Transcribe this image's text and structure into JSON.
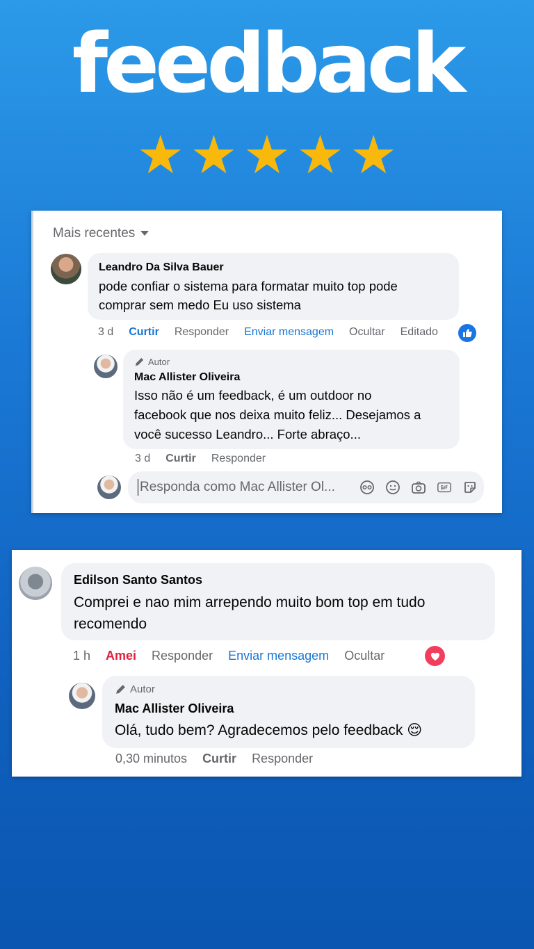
{
  "header": {
    "title": "feedback",
    "stars": [
      "★",
      "★",
      "★",
      "★",
      "★"
    ]
  },
  "card1": {
    "sort_label": "Mais recentes",
    "comment": {
      "author": "Leandro Da Silva Bauer",
      "text_line1": "pode confiar o sistema para formatar muito top pode",
      "text_line2": "comprar sem medo Eu uso sistema",
      "time": "3 d",
      "like": "Curtir",
      "reply": "Responder",
      "message": "Enviar mensagem",
      "hide": "Ocultar",
      "edited": "Editado",
      "reaction_icon": "thumbs-up-icon"
    },
    "reply": {
      "tag": "Autor",
      "author": "Mac Allister Oliveira",
      "text_line1": "Isso não é um feedback, é um outdoor no",
      "text_line2": "facebook que nos deixa muito feliz... Desejamos a",
      "text_line3": "você sucesso Leandro... Forte abraço...",
      "time": "3 d",
      "like": "Curtir",
      "reply": "Responder"
    },
    "reply_box": {
      "placeholder": "Responda como Mac Allister Ol...",
      "icons": [
        "avatar-sticker-icon",
        "emoji-icon",
        "camera-icon",
        "gif-icon",
        "sticker-icon"
      ]
    }
  },
  "card2": {
    "comment": {
      "author": "Edilson Santo Santos",
      "text_line1": "Comprei e nao mim arrependo muito bom top em tudo",
      "text_line2": "recomendo",
      "time": "1 h",
      "like": "Amei",
      "reply": "Responder",
      "message": "Enviar mensagem",
      "hide": "Ocultar",
      "reaction_icon": "heart-icon"
    },
    "reply": {
      "tag": "Autor",
      "author": "Mac Allister Oliveira",
      "text": "Olá, tudo bem? Agradecemos pelo feedback",
      "emoji": "😌",
      "time": "0,30 minutos",
      "like": "Curtir",
      "reply": "Responder"
    }
  },
  "colors": {
    "background_top": "#2c9ae8",
    "background_bottom": "#0a56b0",
    "star": "#f9b90c",
    "facebook_blue": "#1876d2",
    "love_red": "#e41e3f",
    "bubble": "#f0f2f5"
  }
}
